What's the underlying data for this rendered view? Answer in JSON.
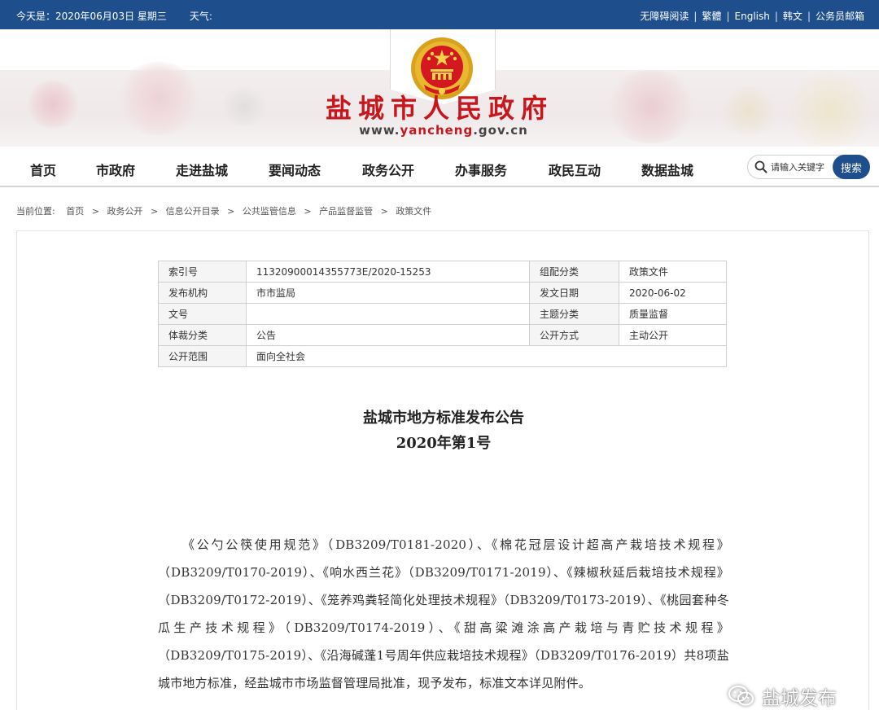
{
  "topbar": {
    "date_text": "今天是：2020年06月03日 星期三",
    "weather_label": "天气:",
    "links": [
      "无障碍阅读",
      "繁體",
      "English",
      "韩文",
      "公务员邮箱"
    ]
  },
  "header": {
    "site_title": "盐城市人民政府",
    "url_prefix": "www.",
    "url_highlight": "yancheng",
    "url_suffix": ".gov.cn"
  },
  "nav": {
    "items": [
      "首页",
      "市政府",
      "走进盐城",
      "要闻动态",
      "政务公开",
      "办事服务",
      "政民互动",
      "数据盐城"
    ],
    "search_placeholder": "请输入关键字",
    "search_button": "搜索"
  },
  "breadcrumb": {
    "label": "当前位置:",
    "items": [
      "首页",
      "政务公开",
      "信息公开目录",
      "公共监管信息",
      "产品监督监管",
      "政策文件"
    ]
  },
  "meta": {
    "rows": [
      {
        "k1": "索引号",
        "v1": "11320900014355773E/2020-15253",
        "k2": "组配分类",
        "v2": "政策文件"
      },
      {
        "k1": "发布机构",
        "v1": "市市监局",
        "k2": "发文日期",
        "v2": "2020-06-02"
      },
      {
        "k1": "文号",
        "v1": "",
        "k2": "主题分类",
        "v2": "质量监督"
      },
      {
        "k1": "体裁分类",
        "v1": "公告",
        "k2": "公开方式",
        "v2": "主动公开"
      },
      {
        "k1": "公开范围",
        "v1": "面向全社会"
      }
    ]
  },
  "document": {
    "title": "盐城市地方标准发布公告",
    "subtitle": "2020年第1号",
    "body": "《公勺公筷使用规范》（DB3209/T0181-2020）、《棉花冠层设计超高产栽培技术规程》（DB3209/T0170-2019）、《响水西兰花》（DB3209/T0171-2019）、《辣椒秋延后栽培技术规程》（DB3209/T0172-2019）、《笼养鸡粪轻简化处理技术规程》（DB3209/T0173-2019）、《桃园套种冬瓜生产技术规程》（DB3209/T0174-2019）、《甜高粱滩涂高产栽培与青贮技术规程》（DB3209/T0175-2019）、《沿海碱蓬1号周年供应栽培技术规程》（DB3209/T0176-2019）共8项盐城市地方标准，经盐城市市场监督管理局批准，现予发布，标准文本详见附件。"
  },
  "watermark": {
    "text": "盐城发布",
    "icon": "wechat-icon"
  },
  "colors": {
    "topbar": "#1e4e8c",
    "title_red": "#c8161d",
    "search_button": "#1e4e8c"
  }
}
